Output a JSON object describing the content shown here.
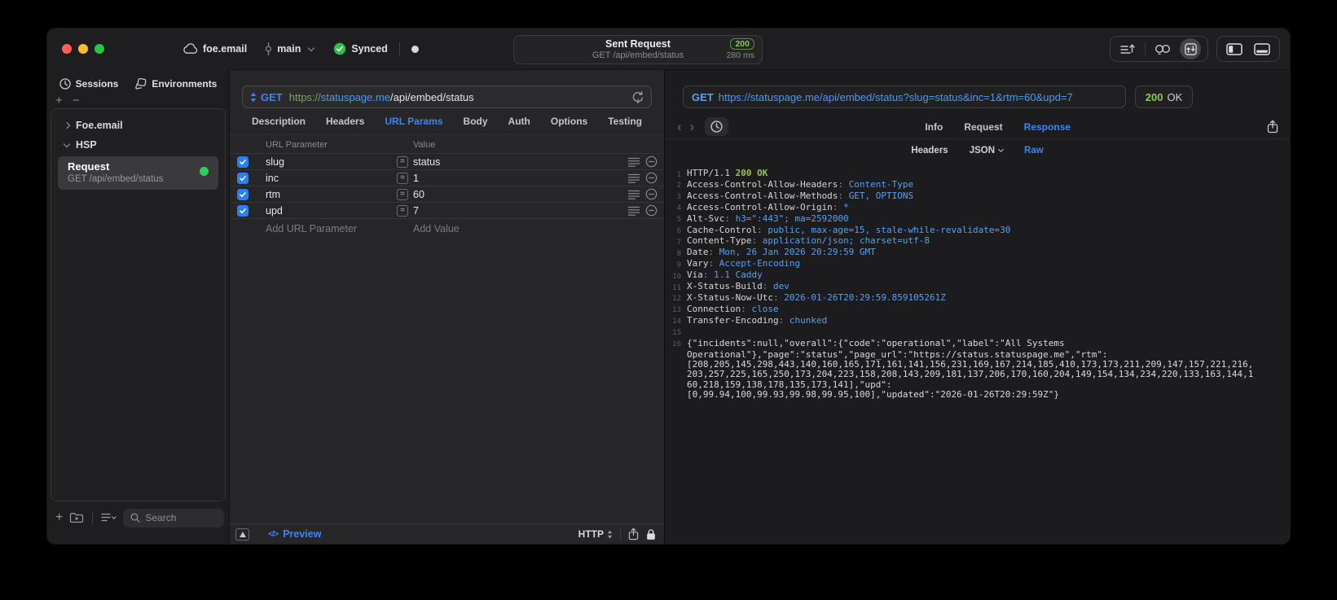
{
  "titlebar": {
    "project": "foe.email",
    "branch": "main",
    "sync_status": "Synced",
    "request_summary": {
      "title": "Sent Request",
      "subtitle": "GET /api/embed/status",
      "status_code": "200",
      "duration": "280 ms"
    }
  },
  "sidebar": {
    "tabs": [
      {
        "label": "Sessions",
        "icon": "clock-icon"
      },
      {
        "label": "Environments",
        "icon": "layers-icon"
      }
    ],
    "tree": [
      {
        "label": "Foe.email",
        "state": "collapsed"
      },
      {
        "label": "HSP",
        "state": "expanded"
      }
    ],
    "request_item": {
      "title": "Request",
      "subtitle": "GET /api/embed/status",
      "status_color": "#30d158"
    },
    "search_placeholder": "Search"
  },
  "request_pane": {
    "method": "GET",
    "url": {
      "scheme": "https://",
      "host": "statuspage.me",
      "path": "/api/embed/status"
    },
    "tabs": [
      "Description",
      "Headers",
      "URL Params",
      "Body",
      "Auth",
      "Options",
      "Testing"
    ],
    "active_tab": "URL Params",
    "params_table": {
      "columns": [
        "URL Parameter",
        "Value"
      ],
      "rows": [
        {
          "enabled": true,
          "name": "slug",
          "value": "status"
        },
        {
          "enabled": true,
          "name": "inc",
          "value": "1"
        },
        {
          "enabled": true,
          "name": "rtm",
          "value": "60"
        },
        {
          "enabled": true,
          "name": "upd",
          "value": "7"
        }
      ],
      "add_param_placeholder": "Add URL Parameter",
      "add_value_placeholder": "Add Value"
    },
    "footer": {
      "code_icon": "</>",
      "preview_label": "Preview",
      "protocol_label": "HTTP"
    }
  },
  "response_pane": {
    "method": "GET",
    "url": "https://statuspage.me/api/embed/status?slug=status&inc=1&rtm=60&upd=7",
    "status_code": "200",
    "status_text": "OK",
    "tabs": [
      "Info",
      "Request",
      "Response"
    ],
    "active_tab": "Response",
    "subtabs": [
      "Headers",
      "JSON",
      "Raw"
    ],
    "active_subtab": "Raw",
    "body": {
      "status_line": {
        "num": "1",
        "protocol": "HTTP/1.1 ",
        "status": "200 OK"
      },
      "headers": [
        {
          "num": "2",
          "name": "Access-Control-Allow-Headers",
          "value": "Content-Type"
        },
        {
          "num": "3",
          "name": "Access-Control-Allow-Methods",
          "value": "GET, OPTIONS"
        },
        {
          "num": "4",
          "name": "Access-Control-Allow-Origin",
          "value": "*"
        },
        {
          "num": "5",
          "name": "Alt-Svc",
          "value": "h3=\":443\"; ma=2592000"
        },
        {
          "num": "6",
          "name": "Cache-Control",
          "value": "public, max-age=15, stale-while-revalidate=30"
        },
        {
          "num": "7",
          "name": "Content-Type",
          "value": "application/json; charset=utf-8"
        },
        {
          "num": "8",
          "name": "Date",
          "value": "Mon, 26 Jan 2026 20:29:59 GMT"
        },
        {
          "num": "9",
          "name": "Vary",
          "value": "Accept-Encoding"
        },
        {
          "num": "10",
          "name": "Via",
          "value": "1.1 Caddy"
        },
        {
          "num": "11",
          "name": "X-Status-Build",
          "value": "dev"
        },
        {
          "num": "12",
          "name": "X-Status-Now-Utc",
          "value": "2026-01-26T20:29:59.859105261Z"
        },
        {
          "num": "13",
          "name": "Connection",
          "value": "close"
        },
        {
          "num": "14",
          "name": "Transfer-Encoding",
          "value": "chunked"
        }
      ],
      "blank_line_num": "15",
      "json_line_num": "16",
      "json_lines": [
        "{\"incidents\":null,\"overall\":{\"code\":\"operational\",\"label\":\"All Systems",
        "Operational\"},\"page\":\"status\",\"page_url\":\"https://status.statuspage.me\",\"rtm\":",
        "[208,205,145,298,443,140,160,165,171,161,141,156,231,169,167,214,185,410,173,173,211,209,147,157,221,216,",
        "203,257,225,165,250,173,204,223,158,208,143,209,181,137,206,170,160,204,149,154,134,234,220,133,163,144,1",
        "60,218,159,138,178,135,173,141],\"upd\":",
        "[0,99.94,100,99.93,99.98,99.95,100],\"updated\":\"2026-01-26T20:29:59Z\"}"
      ]
    }
  },
  "colors": {
    "accent_blue": "#3f82f7",
    "value_blue": "#57a0f0",
    "success_green": "#30d158",
    "badge_green": "#8cc656"
  }
}
